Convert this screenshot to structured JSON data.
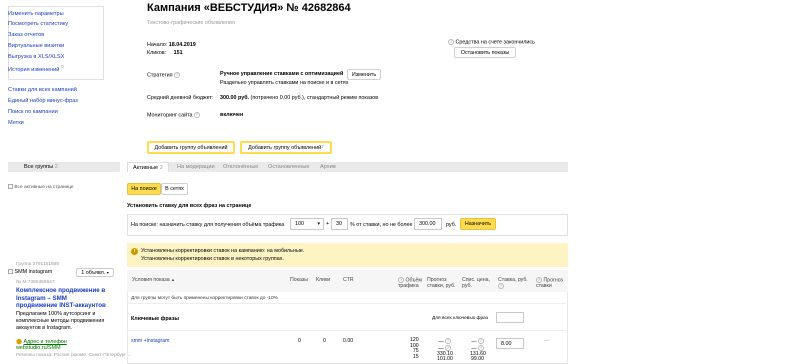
{
  "sidebar": {
    "top_items": [
      "Изменить параметры",
      "Посмотреть статистику",
      "Заказ отчетов",
      "Виртуальные визитки",
      "Выгрузка в XLS/XLSX"
    ],
    "history_label": "История изменений",
    "history_count": "0",
    "bottom_items": [
      "Ставки для всех кампаний",
      "Единый набор минус-фраз",
      "Поиск по кампании",
      "Метки"
    ],
    "show_active_label": "Все активные на странице"
  },
  "header": {
    "title": "Кампания «ВЕБСТУДИЯ» № 42682864",
    "subtitle": "Текстово-графические объявления"
  },
  "info": {
    "start_label": "Начало:",
    "start_value": "18.04.2019",
    "clicks_label": "Кликов:",
    "clicks_value": "151",
    "funds_notice": "Средства на счете закончились",
    "stop_button": "Остановить показы",
    "strategy_label": "Стратегия",
    "strategy_name": "Ручное управление ставками с оптимизацией",
    "strategy_desc": "Раздельно управлять ставками на поиске и в сетях",
    "change_button": "Изменить",
    "budget_label": "Средний дневной бюджет:",
    "budget_value": "300.00 руб.",
    "budget_desc": "(потрачено 0.00 руб.), стандартный режим показов",
    "monitor_label": "Мониторинг сайта",
    "monitor_value": "включен"
  },
  "actions": {
    "add_group_1": "Добавить группу объявлений",
    "add_group_2": "Добавить группу объявлений",
    "add_group_2_sup": "2"
  },
  "tabs": {
    "all_groups": "Все группы",
    "all_groups_count": "2",
    "items": [
      {
        "label": "Активные",
        "count": "2",
        "active": true
      },
      {
        "label": "На модерации",
        "count": "",
        "active": false
      },
      {
        "label": "Отклонённые",
        "count": "",
        "active": false
      },
      {
        "label": "Остановленные",
        "count": "",
        "active": false
      },
      {
        "label": "Архив",
        "count": "",
        "active": false
      }
    ]
  },
  "network": {
    "search": "На поиске",
    "networks": "В сетях"
  },
  "bids": {
    "title": "Установить ставку для всех фраз на странице",
    "on_search_label": "На поиске:",
    "instruction": "назначить ставку для получения объёма трафика",
    "traffic_value": "100",
    "plus": "+",
    "percent_value": "30",
    "percent_text": "% от ставки, но не более",
    "max_value": "300.00",
    "currency": "руб.",
    "assign_button": "Назначить"
  },
  "notice": {
    "line1": "Установлены корректировки ставок на кампанию: на мобильные.",
    "line2": "Установлены корректировки ставок в некоторых группах."
  },
  "group": {
    "group_id": "Группа 3791151588",
    "name": "SMM instagram",
    "ads_count": "1 объявл.",
    "ad_id": "№ М 7380456847",
    "ad_title": "Комплексное продвижение в Instagram – SMM продвижение INST-аккаунтов",
    "ad_text": "Предлагаем 100% аутсорсинг и комплексные методы продвижения аккаунтов в Instagram.",
    "address_link": "Адрес и телефон",
    "display_url": "webstudio.ru/SMM",
    "regions": "Регионы показа: Россия (кроме: Санкт-Петербург ..."
  },
  "table": {
    "headers": {
      "conditions": "Условия показа",
      "shows": "Показы",
      "clicks": "Клики",
      "ctr": "CTR",
      "traffic": "Объём трафика",
      "forecast_bid": "Прогноз ставки, руб.",
      "writeoff": "Спис. цена, руб.",
      "bid": "Ставка, руб.",
      "forecast": "Прогноз ставки"
    },
    "adjust_notice": "Для группы могут быть применены корректировки ставок до -10%",
    "keywords_label": "Ключевые фразы",
    "all_keywords_label": "Для всех ключевых фраз",
    "rows": [
      {
        "phrase": "smm +instagram",
        "shows": "0",
        "clicks": "0",
        "ctr": "0.00",
        "traffic": [
          "120",
          "100",
          "75",
          "15"
        ],
        "forecast_bids": [
          "",
          "",
          "330.10",
          "101.00"
        ],
        "writeoff": [
          "",
          "",
          "131.60",
          "99.00"
        ],
        "bid": "8.00"
      }
    ]
  }
}
